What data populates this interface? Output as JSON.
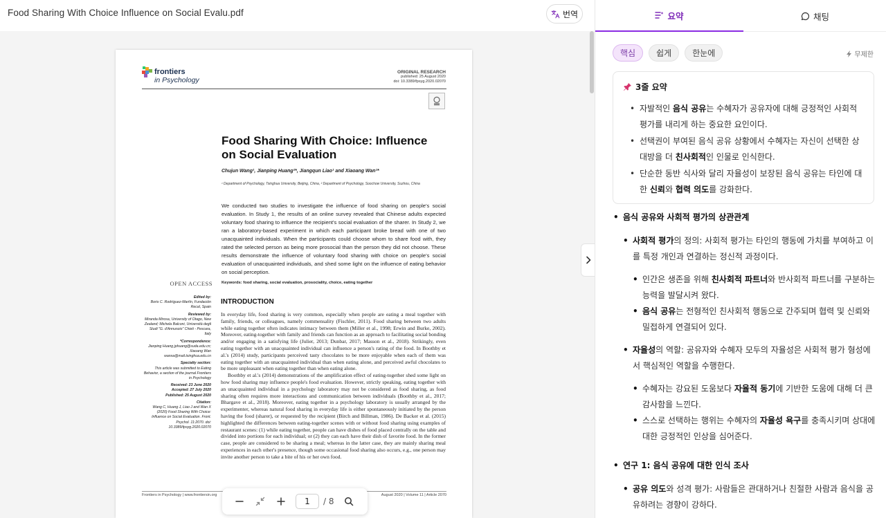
{
  "viewer": {
    "file_title": "Food Sharing With Choice Influence on Social Evalu.pdf",
    "translate_label": "번역",
    "page_current": "1",
    "page_total": "/ 8"
  },
  "pdf": {
    "logo_name": "frontiers",
    "logo_sub": "in Psychology",
    "article_type": "ORIGINAL RESEARCH",
    "published": "published: 25 August 2020",
    "doi": "doi: 10.3389/fpsyg.2020.02070",
    "title_line1": "Food Sharing With Choice: Influence",
    "title_line2": "on Social Evaluation",
    "authors": "Chujun Wang¹, Jianping Huang²*, Jiangqun Liao¹ and Xiaoang Wan¹*",
    "affiliations": "¹ Department of Psychology, Tsinghua University, Beijing, China, ² Department of Psychology, Soochow University, Suzhou, China",
    "abstract": "We conducted two studies to investigate the influence of food sharing on people's social evaluation. In Study 1, the results of an online survey revealed that Chinese adults expected voluntary food sharing to influence the recipient's social evaluation of the sharer. In Study 2, we ran a laboratory-based experiment in which each participant broke bread with one of two unacquainted individuals. When the participants could choose whom to share food with, they rated the selected person as being more prosocial than the person they did not choose. These results demonstrate the influence of voluntary food sharing with choice on people's social evaluation of unacquainted individuals, and shed some light on the influence of eating behavior on social perception.",
    "keywords_label": "Keywords:",
    "keywords": "food sharing, social evaluation, prosociality, choice, eating together",
    "open_access": "OPEN ACCESS",
    "meta": [
      {
        "label": "Edited by:",
        "text": "Boris C. Rodríguez-Martín, Fundación Recal, Spain"
      },
      {
        "label": "Reviewed by:",
        "text": "Miranda Mirosa, University of Otago, New Zealand; Michela Balconi, Università degli Studi \"G. d'Annunzio\" Chieti - Pescara, Italy"
      },
      {
        "label": "*Correspondence:",
        "text": "Jianping Huang jphuang@suda.edu.cn; Xiaoang Wan wanxa@mail.tsinghua.edu.cn"
      },
      {
        "label": "Specialty section:",
        "text": "This article was submitted to Eating Behavior, a section of the journal Frontiers in Psychology"
      },
      {
        "label": "Received: 23 June 2020",
        "text": ""
      },
      {
        "label": "Accepted: 27 July 2020",
        "text": ""
      },
      {
        "label": "Published: 25 August 2020",
        "text": ""
      },
      {
        "label": "Citation:",
        "text": "Wang C, Huang J, Liao J and Wan X (2020) Food Sharing With Choice: Influence on Social Evaluation. Front. Psychol. 11:2070. doi: 10.3389/fpsyg.2020.02070"
      }
    ],
    "intro_heading": "INTRODUCTION",
    "intro_p1": "In everyday life, food sharing is very common, especially when people are eating a meal together with family, friends, or colleagues, namely commensality (Fischler, 2011). Food sharing between two adults while eating together often indicates intimacy between them (Miller et al., 1998; Erwin and Burke, 2002). Moreover, eating-together with family and friends can function as an approach to facilitating social bonding and/or engaging in a satisfying life (Julier, 2013; Dunbar, 2017; Masson et al., 2018). Strikingly, even eating together with an unacquainted individual can influence a person's rating of the food. In Boothby et al.'s (2014) study, participants perceived tasty chocolates to be more enjoyable when each of them was eating together with an unacquainted individual than when eating alone, and perceived awful chocolates to be more unpleasant when eating together than when eating alone.",
    "intro_p2": "Boothby et al.'s (2014) demonstrations of the amplification effect of eating-together shed some light on how food sharing may influence people's food evaluation. However, strictly speaking, eating together with an unacquainted individual in a psychology laboratory may not be considered as food sharing, as food sharing often requires more interactions and communication between individuals (Boothby et al., 2017; Bhargave et al., 2018). Moreover, eating together in a psychology laboratory is usually arranged by the experimenter, whereas natural food sharing in everyday life is either spontaneously initiated by the person having the food (sharer), or requested by the recipient (Birch and Billman, 1986). De Backer et al. (2015) highlighted the differences between eating-together scenes with or without food sharing using examples of restaurant scenes: (1) while eating together, people can have dishes of food placed centrally on the table and divided into portions for each individual; or (2) they can each have their dish of favorite food. In the former case, people are considered to be sharing a meal; whereas in the latter case, they are mainly sharing meal experiences in each other's presence, though some occasional food sharing also occurs, e.g., one person may invite another person to take a bite of his or her own food.",
    "footer_left": "Frontiers in Psychology | www.frontiersin.org",
    "footer_center": "1",
    "footer_right": "August 2020 | Volume 11 | Article 2070"
  },
  "panel": {
    "tab_summary": "요약",
    "tab_chat": "채팅",
    "chips": [
      "핵심",
      "쉽게",
      "한눈에"
    ],
    "unlimited": "무제한",
    "summary_head": "3줄 요약",
    "summary_items": [
      {
        "pre": "자발적인 ",
        "bold": "음식 공유",
        "post": "는 수혜자가 공유자에 대해 긍정적인 사회적 평가를 내리게 하는 중요한 요인이다."
      },
      {
        "pre": "선택권이 부여된 음식 공유 상황에서 수혜자는 자신이 선택한 상대방을 더 ",
        "bold": "친사회적",
        "post": "인 인물로 인식한다."
      },
      {
        "pre": "단순한 동반 식사와 달리 자율성이 보장된 음식 공유는 타인에 대한 ",
        "bold": "신뢰",
        "mid": "와 ",
        "bold2": "협력 의도",
        "post": "를 강화한다."
      }
    ],
    "outline": {
      "h1": "음식 공유와 사회적 평가의 상관관계",
      "a_bold": "사회적 평가",
      "a_text": "의 정의: 사회적 평가는 타인의 행동에 가치를 부여하고 이를 특정 개인과 연결하는 정신적 과정이다.",
      "a1_pre": "인간은 생존을 위해 ",
      "a1_bold": "친사회적 파트너",
      "a1_post": "와 반사회적 파트너를 구분하는 능력을 발달시켜 왔다.",
      "a2_bold": "음식 공유",
      "a2_post": "는 전형적인 친사회적 행동으로 간주되며 협력 및 신뢰와 밀접하게 연결되어 있다.",
      "b_bold": "자율성",
      "b_text": "의 역할: 공유자와 수혜자 모두의 자율성은 사회적 평가 형성에서 핵심적인 역할을 수행한다.",
      "b1_pre": "수혜자는 강요된 도움보다 ",
      "b1_bold": "자율적 동기",
      "b1_post": "에 기반한 도움에 대해 더 큰 감사함을 느낀다.",
      "b2_pre": "스스로 선택하는 행위는 수혜자의 ",
      "b2_bold": "자율성 욕구",
      "b2_post": "를 충족시키며 상대에 대한 긍정적인 인상을 심어준다.",
      "h2": "연구 1: 음식 공유에 대한 인식 조사",
      "c_bold": "공유 의도",
      "c_text": "와 성격 평가: 사람들은 관대하거나 친절한 사람과 음식을 공유하려는 경향이 강하다."
    }
  },
  "colors": {
    "accent": "#8a2be2",
    "chip_active_bg": "#f4e4fb",
    "link": "#3b6aa8"
  }
}
